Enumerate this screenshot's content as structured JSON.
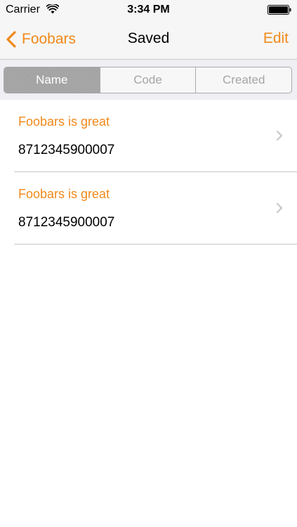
{
  "status_bar": {
    "carrier": "Carrier",
    "time": "3:34 PM",
    "wifi_icon": "wifi-icon",
    "battery_icon": "battery-icon"
  },
  "nav_bar": {
    "back_label": "Foobars",
    "back_icon": "chevron-left-icon",
    "title": "Saved",
    "edit_label": "Edit"
  },
  "segmented_control": {
    "segments": [
      "Name",
      "Code",
      "Created"
    ],
    "selected": "Name"
  },
  "list": {
    "items": [
      {
        "title": "Foobars is great",
        "code": "8712345900007"
      },
      {
        "title": "Foobars is great",
        "code": "8712345900007"
      }
    ]
  },
  "colors": {
    "accent": "#f0891a",
    "nav_background": "#f6f6f6",
    "segment_area_background": "#efeff4",
    "segment_selected": "#a6a6a6",
    "separator": "#c8c7cc"
  }
}
